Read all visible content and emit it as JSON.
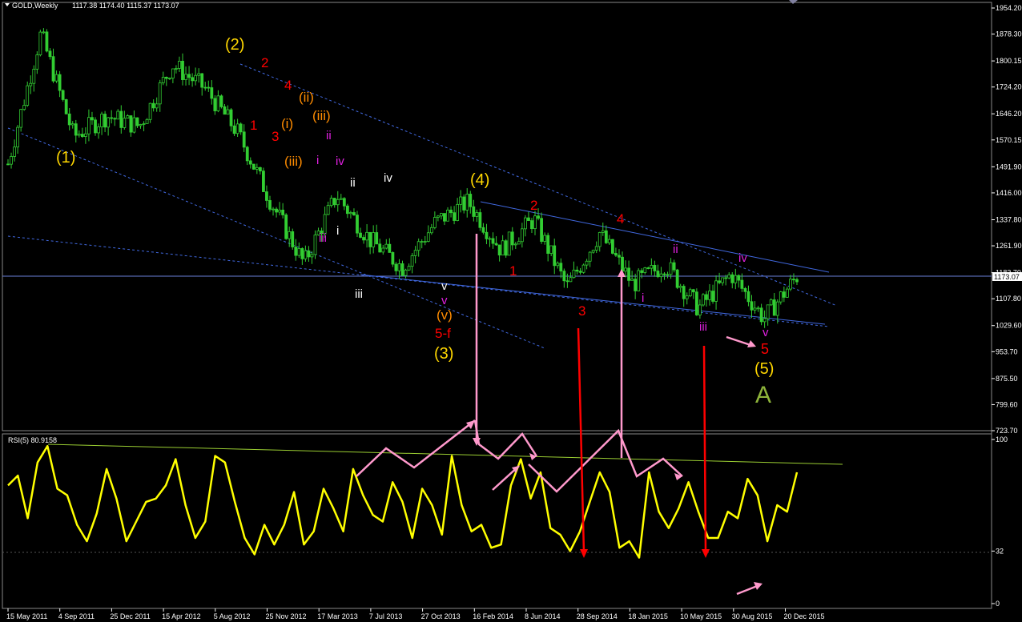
{
  "header": {
    "symbol": "GOLD,Weekly",
    "ohlc": "1117.38 1174.40 1115.37 1173.07",
    "rsi_label": "RSI(5) 80.9158"
  },
  "colors": {
    "background": "#000000",
    "candles": "#32cd32",
    "rsi": "#ffff00",
    "channel": "#4169e1",
    "pink_arrows": "#ff99cc",
    "red_arrows": "#ff0000",
    "rsi_trend": "#9acd32",
    "label_yellow": "#ffd700",
    "label_red": "#ff0000",
    "label_orange": "#ff8c00",
    "label_magenta": "#e020e0",
    "label_white": "#ffffff",
    "label_green": "#8db33a"
  },
  "chart_data": [
    {
      "type": "candlestick",
      "title": "GOLD,Weekly",
      "price_axis_ticks": [
        "1954.20",
        "1878.30",
        "1800.15",
        "1724.20",
        "1646.20",
        "1570.15",
        "1491.90",
        "1416.00",
        "1337.80",
        "1261.90",
        "1183.70",
        "1107.80",
        "1029.60",
        "953.70",
        "875.50",
        "799.60",
        "723.70"
      ],
      "current_price_tag": "1173.07",
      "x_tick_labels": [
        "15 May 2011",
        "4 Sep 2011",
        "25 Dec 2011",
        "15 Apr 2012",
        "5 Aug 2012",
        "25 Nov 2012",
        "17 Mar 2013",
        "7 Jul 2013",
        "27 Oct 2013",
        "16 Feb 2014",
        "8 Jun 2014",
        "28 Sep 2014",
        "18 Jan 2015",
        "10 May 2015",
        "30 Aug 2015",
        "20 Dec 2015"
      ],
      "close_path_approx": [
        {
          "x": "15 May 2011",
          "y": 1500
        },
        {
          "x": "4 Sep 2011",
          "y": 1880
        },
        {
          "x": "25 Dec 2011",
          "y": 1580
        },
        {
          "x": "15 Apr 2012",
          "y": 1640
        },
        {
          "x": "5 Aug 2012",
          "y": 1610
        },
        {
          "x": "Oct 2012",
          "y": 1790
        },
        {
          "x": "25 Nov 2012",
          "y": 1720
        },
        {
          "x": "17 Mar 2013",
          "y": 1590
        },
        {
          "x": "Apr 2013",
          "y": 1390
        },
        {
          "x": "7 Jul 2013",
          "y": 1210
        },
        {
          "x": "Aug 2013",
          "y": 1410
        },
        {
          "x": "27 Oct 2013",
          "y": 1280
        },
        {
          "x": "Dec 2013",
          "y": 1200
        },
        {
          "x": "16 Feb 2014",
          "y": 1330
        },
        {
          "x": "Mar 2014",
          "y": 1390
        },
        {
          "x": "8 Jun 2014",
          "y": 1250
        },
        {
          "x": "Jul 2014",
          "y": 1340
        },
        {
          "x": "28 Sep 2014",
          "y": 1140
        },
        {
          "x": "18 Jan 2015",
          "y": 1300
        },
        {
          "x": "Mar 2015",
          "y": 1150
        },
        {
          "x": "10 May 2015",
          "y": 1210
        },
        {
          "x": "Jul 2015",
          "y": 1080
        },
        {
          "x": "30 Aug 2015",
          "y": 1180
        },
        {
          "x": "Dec 2015",
          "y": 1050
        },
        {
          "x": "Jan 2016",
          "y": 1173
        }
      ],
      "wave_labels": [
        {
          "text": "(1)",
          "color": "#ffd700"
        },
        {
          "text": "(2)",
          "color": "#ffd700"
        },
        {
          "text": "2",
          "color": "#ff0000"
        },
        {
          "text": "4",
          "color": "#ff0000"
        },
        {
          "text": "(ii)",
          "color": "#ff8c00"
        },
        {
          "text": "1",
          "color": "#ff0000"
        },
        {
          "text": "(i)",
          "color": "#ff8c00"
        },
        {
          "text": "(iii)",
          "color": "#ff8c00"
        },
        {
          "text": "ii",
          "color": "#e020e0"
        },
        {
          "text": "3",
          "color": "#ff0000"
        },
        {
          "text": "(iii)",
          "color": "#ff8c00"
        },
        {
          "text": "i",
          "color": "#e020e0"
        },
        {
          "text": "iv",
          "color": "#e020e0"
        },
        {
          "text": "ii",
          "color": "#ffffff"
        },
        {
          "text": "iv",
          "color": "#ffffff"
        },
        {
          "text": "iii",
          "color": "#e020e0"
        },
        {
          "text": "i",
          "color": "#ffffff"
        },
        {
          "text": "iii",
          "color": "#ffffff"
        },
        {
          "text": "(4)",
          "color": "#ffd700"
        },
        {
          "text": "2",
          "color": "#ff0000"
        },
        {
          "text": "4",
          "color": "#ff0000"
        },
        {
          "text": "1",
          "color": "#ff0000"
        },
        {
          "text": "v",
          "color": "#ffffff"
        },
        {
          "text": "v",
          "color": "#e020e0"
        },
        {
          "text": "(v)",
          "color": "#ff8c00"
        },
        {
          "text": "5-f",
          "color": "#ff0000"
        },
        {
          "text": "(3)",
          "color": "#ffd700"
        },
        {
          "text": "3",
          "color": "#ff0000"
        },
        {
          "text": "ii",
          "color": "#e020e0"
        },
        {
          "text": "i",
          "color": "#e020e0"
        },
        {
          "text": "iv",
          "color": "#e020e0"
        },
        {
          "text": "iii",
          "color": "#e020e0"
        },
        {
          "text": "v",
          "color": "#e020e0"
        },
        {
          "text": "5",
          "color": "#ff0000"
        },
        {
          "text": "(5)",
          "color": "#ffd700"
        },
        {
          "text": "A",
          "color": "#8db33a"
        }
      ]
    },
    {
      "type": "line",
      "title": "RSI(5) 80.9158",
      "y_ticks": [
        "100",
        "32",
        "0"
      ],
      "ylim": [
        0,
        100
      ],
      "values": [
        72,
        78,
        52,
        86,
        96,
        70,
        66,
        48,
        38,
        55,
        82,
        64,
        38,
        50,
        62,
        64,
        72,
        88,
        60,
        40,
        50,
        90,
        86,
        62,
        40,
        30,
        48,
        36,
        48,
        68,
        36,
        44,
        70,
        58,
        44,
        82,
        66,
        54,
        50,
        74,
        62,
        40,
        70,
        60,
        42,
        90,
        60,
        44,
        48,
        34,
        36,
        72,
        88,
        64,
        80,
        46,
        42,
        32,
        44,
        62,
        80,
        68,
        34,
        38,
        28,
        80,
        56,
        46,
        58,
        74,
        56,
        40,
        40,
        56,
        52,
        76,
        66,
        38,
        60,
        56,
        80
      ]
    }
  ]
}
